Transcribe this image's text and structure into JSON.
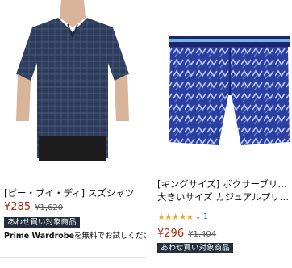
{
  "products": [
    {
      "title": "[ピー・ブイ・ディ] スズシャツ",
      "price": "¥285",
      "list_price": "¥1,620",
      "badge": "あわせ買い対象商品",
      "prime_brand": "Prime Wardrobe",
      "prime_text": "を無料でお試しくださ",
      "image_icon": "tshirt-model-image"
    },
    {
      "title_line1": "[キングサイズ] ボクサーブリーフ",
      "title_line2": "大きいサイズ カジュアルプリント…",
      "stars": "★★★★★",
      "rating_count": "1",
      "price": "¥296",
      "list_price": "¥1,404",
      "badge": "あわせ買い対象商品",
      "image_icon": "boxer-brief-image"
    }
  ],
  "colors": {
    "price": "#b12704",
    "badge_bg": "#232f3e",
    "star": "#f5a623"
  }
}
